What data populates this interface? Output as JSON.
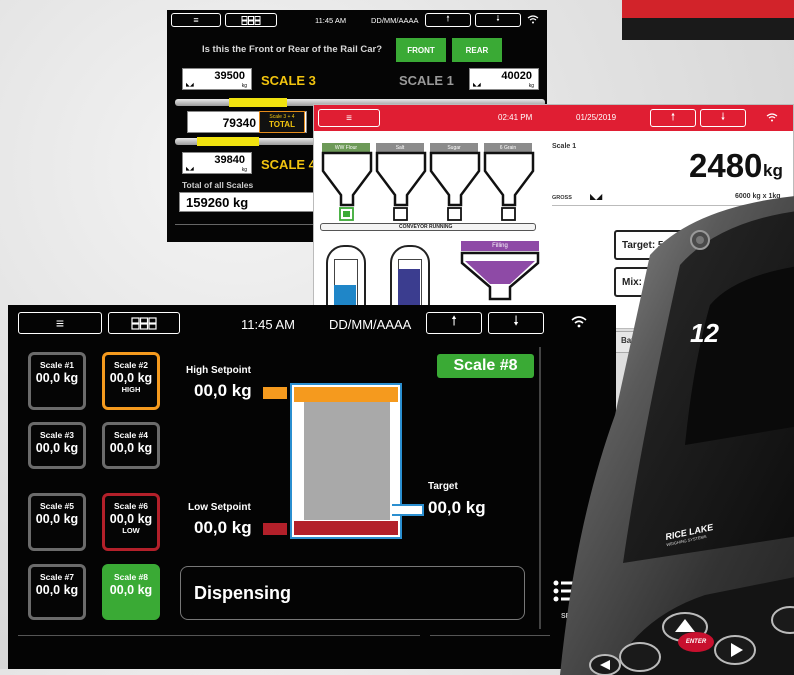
{
  "colors": {
    "accent_green": "#3aaa35",
    "setpoint_orange": "#f59a1e",
    "setpoint_red": "#b3202a",
    "brand_red": "#e01e33",
    "scale_yellow": "#f2c40f"
  },
  "top_nav": {
    "menu_icon": "menu-icon",
    "scales_icon": "scales-grid-icon",
    "time": "11:45 AM",
    "date": "DD/MM/AAAA",
    "up_icon": "arrow-up-icon",
    "down_icon": "arrow-down-icon",
    "wifi_icon": "wifi-icon"
  },
  "rail_screen": {
    "question": "Is this the Front or Rear of the Rail Car?",
    "front_button": "FRONT",
    "rear_button": "REAR",
    "scale3_value": "39500",
    "scale3_label": "SCALE 3",
    "scale1_label": "SCALE 1",
    "scale1_value": "40020",
    "unit_small": "kg",
    "combined_value": "79340",
    "combined_caption": "Scale 3 + 4",
    "combined_label": "TOTAL",
    "scale4_value": "39840",
    "scale4_label": "SCALE 4",
    "total_caption": "Total of all Scales",
    "total_value": "159260 kg"
  },
  "batch_screen": {
    "time": "02:41 PM",
    "date": "01/25/2019",
    "hoppers": [
      "WW Flour",
      "Salt",
      "Sugar",
      "6 Grain"
    ],
    "conveyor": "CONVEYOR RUNNING",
    "filling": "Filling",
    "scale_name": "Scale 1",
    "weight": "2480",
    "unit": "kg",
    "mode": "GROSS",
    "capacity": "6000 kg x 1kg",
    "target": "Target: 5000",
    "mix": "Mix: Al",
    "tab": "Bat"
  },
  "device": {
    "brand": "RICE LAKE",
    "brand_sub": "WEIGHING SYSTEMS",
    "display_digits": "12",
    "enter_key": "ENTER"
  },
  "main_screen": {
    "tiles": [
      {
        "name": "Scale #1",
        "weight": "00,0 kg",
        "status": ""
      },
      {
        "name": "Scale #2",
        "weight": "00,0 kg",
        "status": "HIGH"
      },
      {
        "name": "Scale #3",
        "weight": "00,0 kg",
        "status": ""
      },
      {
        "name": "Scale #4",
        "weight": "00,0 kg",
        "status": ""
      },
      {
        "name": "Scale #5",
        "weight": "00,0 kg",
        "status": ""
      },
      {
        "name": "Scale #6",
        "weight": "00,0 kg",
        "status": "LOW"
      },
      {
        "name": "Scale #7",
        "weight": "00,0 kg",
        "status": ""
      },
      {
        "name": "Scale #8",
        "weight": "00,0 kg",
        "status": ""
      }
    ],
    "high_setpoint_label": "High Setpoint",
    "high_setpoint_value": "00,0 kg",
    "low_setpoint_label": "Low Setpoint",
    "low_setpoint_value": "00,0 kg",
    "target_label": "Target",
    "target_value": "00,0 kg",
    "scale_badge": "Scale #8",
    "status_text": "Dispensing",
    "settings_label": "SET",
    "list_icon": "list-settings-icon"
  }
}
